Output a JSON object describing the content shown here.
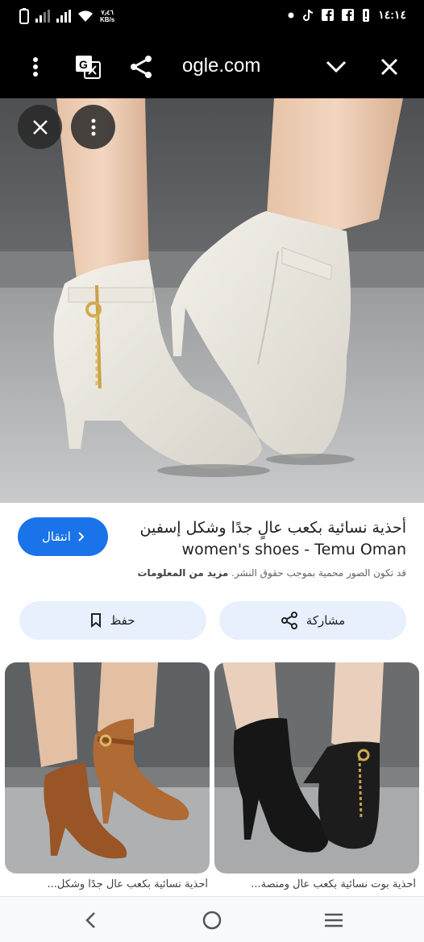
{
  "status_bar": {
    "net_speed_value": "٧٫٤٦",
    "net_speed_unit": "KB/s",
    "time": "١٤:١٤"
  },
  "toolbar": {
    "url": "ogle.com",
    "icons": [
      "more-vert-icon",
      "translate-icon",
      "share-icon",
      "chevron-down-icon",
      "close-icon"
    ]
  },
  "image_viewer": {
    "close_icon": "close-icon",
    "menu_icon": "more-vert-icon"
  },
  "result": {
    "title_ar": "أحذية نسائية بكعب عالٍ جدًا وشكل إسفين",
    "title_en": "women's shoes - Temu Oman",
    "visit_label": "انتقال",
    "copyright_text": "قد تكون الصور محمية بموجب حقوق النشر.",
    "more_info": "مزيد من المعلومات",
    "save_label": "حفظ",
    "share_label": "مشاركة"
  },
  "related": [
    {
      "caption": "أحذية نسائية بكعب عال جدًا وشكل..."
    },
    {
      "caption": "أحذية بوت نسائية بكعب عال ومنصة..."
    }
  ],
  "colors": {
    "accent": "#1a73e8",
    "pill_bg": "#e8f0fe",
    "top_bar": "#000000"
  }
}
